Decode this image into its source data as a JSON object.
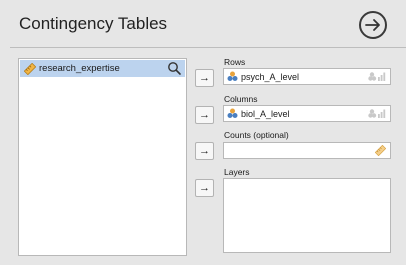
{
  "header": {
    "title": "Contingency Tables",
    "run_icon": "arrow-circle-right-icon"
  },
  "source": {
    "variables": [
      {
        "name": "research_expertise",
        "icon": "ruler-icon"
      }
    ],
    "search_icon": "search-icon"
  },
  "targets": {
    "rows": {
      "label": "Rows",
      "variable": "psych_A_level"
    },
    "columns": {
      "label": "Columns",
      "variable": "biol_A_level"
    },
    "counts": {
      "label": "Counts (optional)"
    },
    "layers": {
      "label": "Layers"
    }
  },
  "arrow_glyph": "→",
  "colors": {
    "selection": "#bcd3ee",
    "background": "#e6e6e6",
    "nominal_blue": "#4a7fc0",
    "nominal_orange": "#e8a33c"
  }
}
